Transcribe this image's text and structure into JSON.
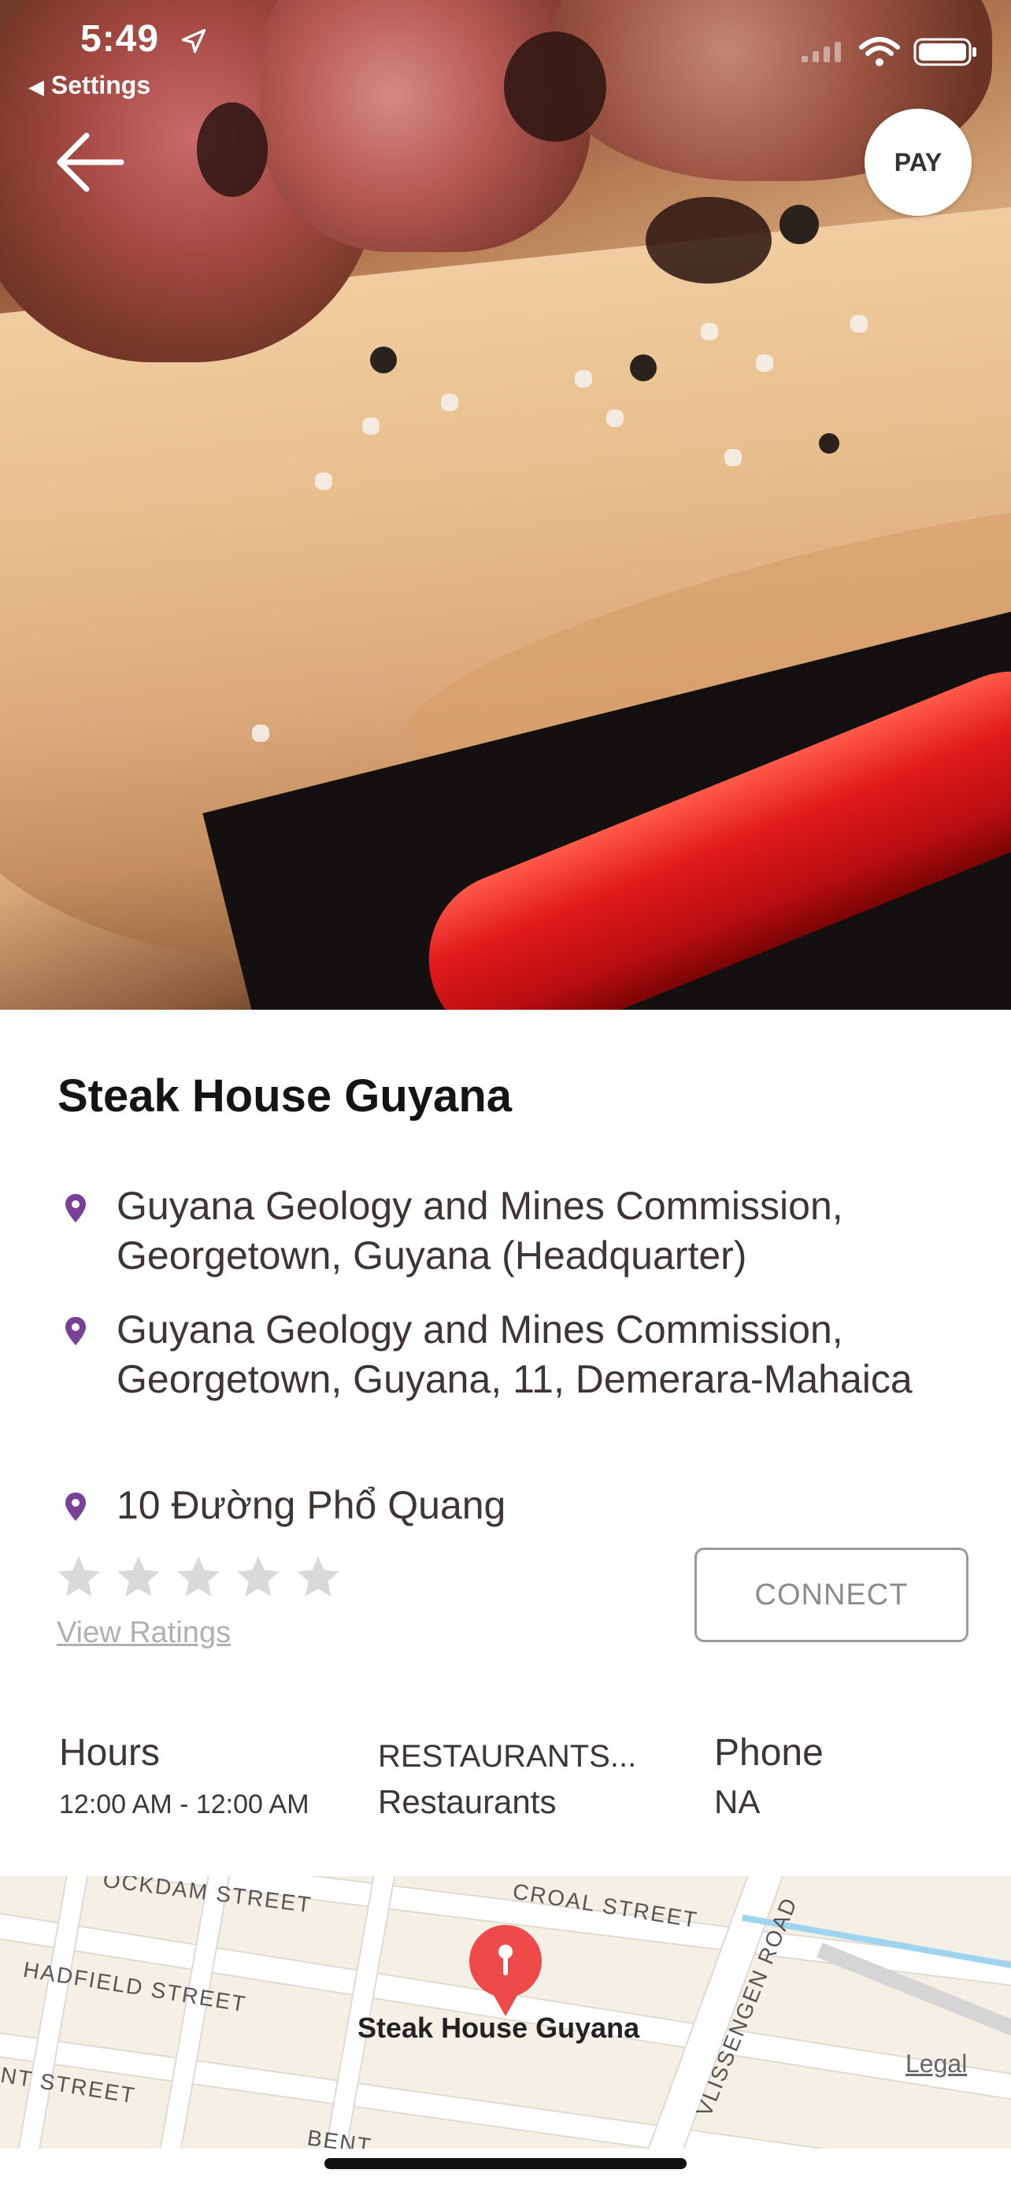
{
  "status_bar": {
    "time": "5:49",
    "back_app": "Settings"
  },
  "header": {
    "pay_label": "PAY"
  },
  "place": {
    "name": "Steak House Guyana",
    "addresses": [
      "Guyana Geology and Mines Commission, Georgetown, Guyana (Headquarter)",
      "Guyana Geology and Mines Commission, Georgetown, Guyana, 11, Demerara-Mahaica",
      "10 Đường Phổ Quang"
    ],
    "rating": 0,
    "view_ratings": "View Ratings",
    "connect_label": "CONNECT"
  },
  "info": {
    "hours_label": "Hours",
    "hours_value": "12:00 AM - 12:00 AM",
    "category_label": "RESTAURANTS...",
    "category_value": "Restaurants",
    "phone_label": "Phone",
    "phone_value": "NA"
  },
  "map": {
    "streets": [
      "OCKDAM STREET",
      "CROAL STREET",
      "HADFIELD STREET",
      "VLISSENGEN ROAD",
      "NT STREET",
      "BENT"
    ],
    "place_label": "Steak House Guyana",
    "legal": "Legal"
  },
  "colors": {
    "accent": "#7a3f96",
    "pin": "#ef4a4a"
  }
}
